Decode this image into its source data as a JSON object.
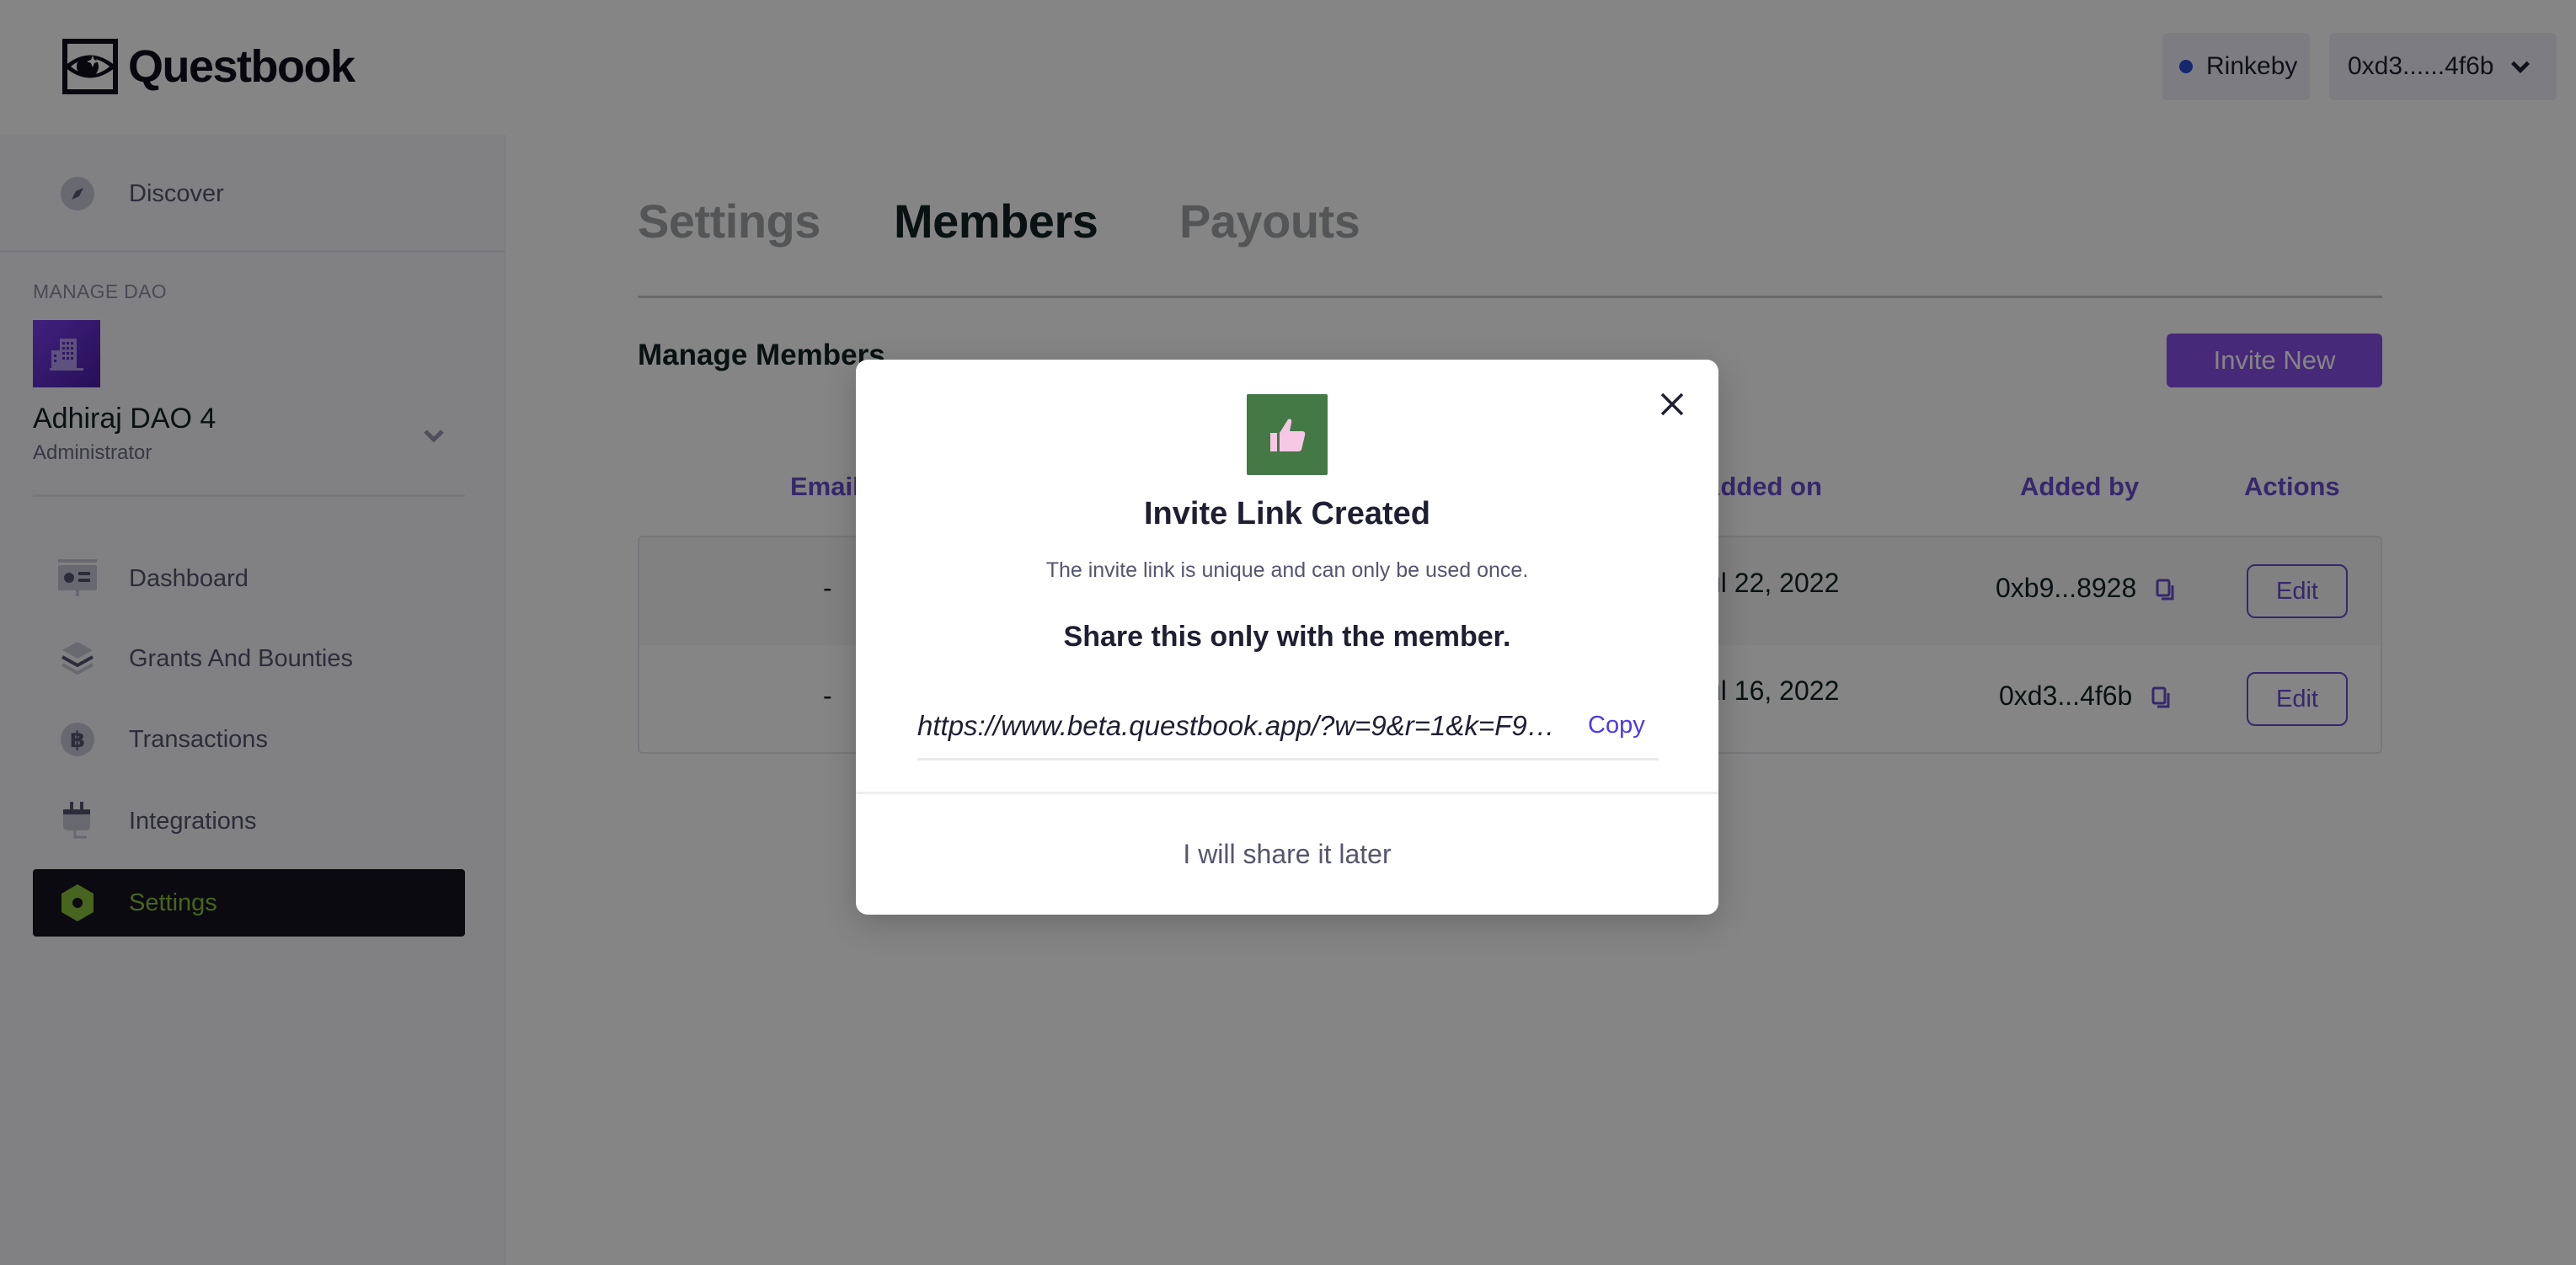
{
  "header": {
    "logo_text": "Questbook",
    "network_label": "Rinkeby",
    "network_dot_color": "#2b4ed1",
    "wallet_address": "0xd3......4f6b"
  },
  "sidebar": {
    "discover_label": "Discover",
    "manage_dao_label": "MANAGE DAO",
    "dao": {
      "name": "Adhiraj DAO 4",
      "role": "Administrator"
    },
    "items": [
      {
        "label": "Dashboard",
        "icon": "dashboard-icon",
        "active": false
      },
      {
        "label": "Grants And Bounties",
        "icon": "layers-icon",
        "active": false
      },
      {
        "label": "Transactions",
        "icon": "bitcoin-icon",
        "active": false
      },
      {
        "label": "Integrations",
        "icon": "plug-icon",
        "active": false
      },
      {
        "label": "Settings",
        "icon": "hex-nut-icon",
        "active": true
      }
    ],
    "active_color": "#88c23a"
  },
  "main": {
    "tabs": [
      {
        "label": "Settings",
        "active": false
      },
      {
        "label": "Members",
        "active": true
      },
      {
        "label": "Payouts",
        "active": false
      }
    ],
    "section_title": "Manage Members",
    "invite_button": "Invite New",
    "accent_color": "#8850ea",
    "table": {
      "headers": [
        "Email",
        "Added on",
        "Added by",
        "Actions"
      ],
      "rows": [
        {
          "email": "-",
          "added_on": "Jul 22, 2022",
          "added_by": "0xb9...8928",
          "action": "Edit"
        },
        {
          "email": "-",
          "added_on": "Jul 16, 2022",
          "added_by": "0xd3...4f6b",
          "action": "Edit"
        }
      ]
    }
  },
  "modal": {
    "icon": "thumbs-up-icon",
    "title": "Invite Link Created",
    "subtitle": "The invite link is unique and can only be used once.",
    "share_note": "Share this only with the member.",
    "link": "https://www.beta.questbook.app/?w=9&r=1&k=F9e...",
    "copy_label": "Copy",
    "later_label": "I will share it later"
  }
}
